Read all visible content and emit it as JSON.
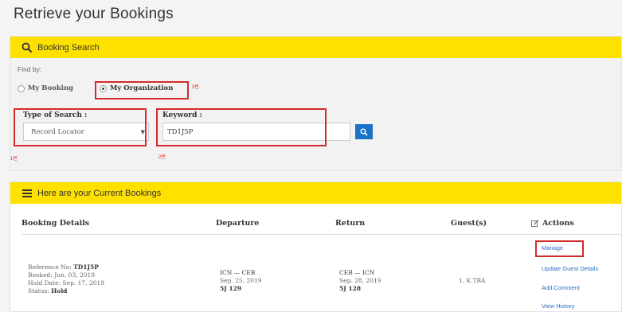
{
  "page": {
    "title": "Retrieve your Bookings"
  },
  "search_panel": {
    "header": "Booking Search",
    "find_by_label": "Find by:",
    "options": [
      "My Booking",
      "My Organization"
    ],
    "selected_option": "My Organization",
    "type_label": "Type of Search :",
    "type_value": "Record Locator",
    "keyword_label": "Keyword :",
    "keyword_value": "TD1J5P",
    "annotations": {
      "a1": "1번",
      "a2": "2번",
      "a3": "3번"
    }
  },
  "bookings_panel": {
    "header": "Here are your Current Bookings",
    "columns": [
      "Booking Details",
      "Departure",
      "Return",
      "Guest(s)",
      "Actions"
    ],
    "row": {
      "reference_label": "Reference No:",
      "reference": "TD1J5P",
      "booked": "Booked: Jun. 03, 2019",
      "hold_date": "Hold Date: Sep. 17, 2019",
      "status_label": "Status:",
      "status": "Hold",
      "departure_route": "ICN — CEB",
      "departure_date": "Sep. 25, 2019",
      "departure_flight": "5J 129",
      "return_route": "CEB — ICN",
      "return_date": "Sep. 28, 2019",
      "return_flight": "5J 128",
      "guests": "1. K TBA"
    },
    "actions": [
      "Manage",
      "Update Guest Details",
      "Add Comment",
      "View History"
    ]
  }
}
